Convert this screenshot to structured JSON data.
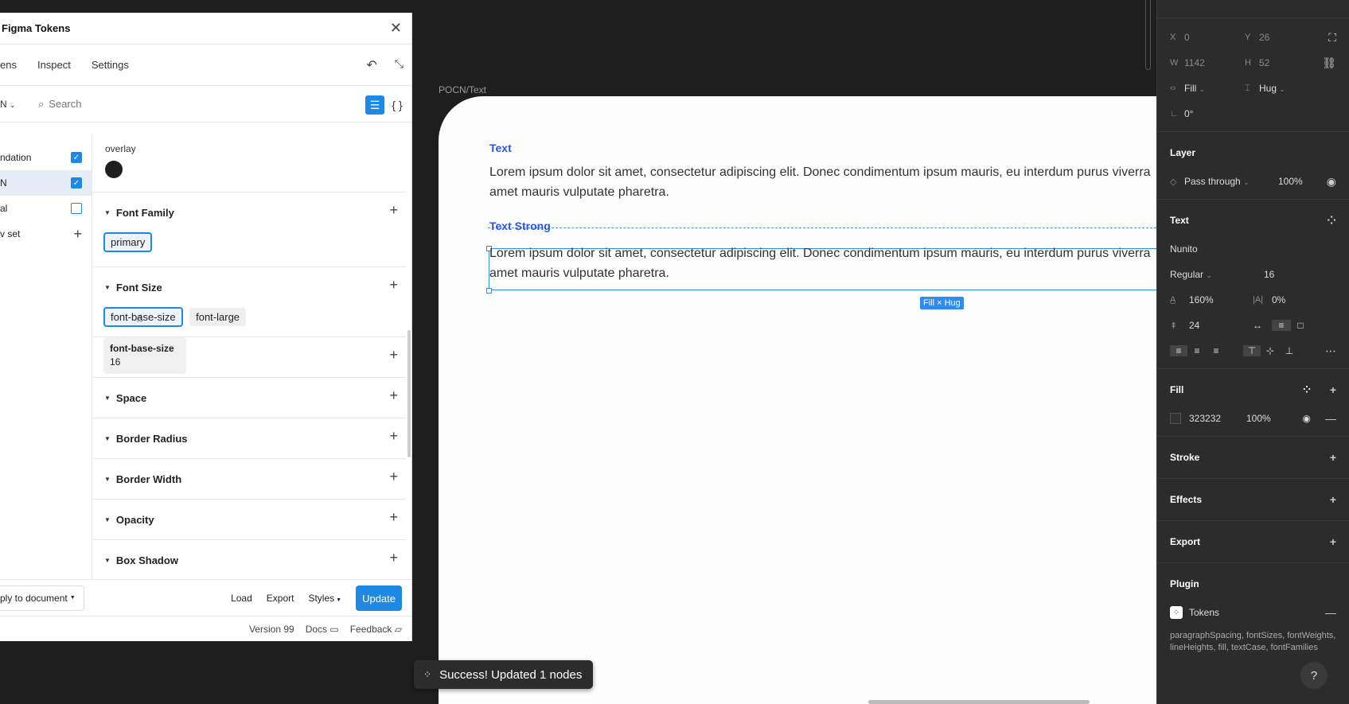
{
  "canvas": {
    "frame_label": "POCN/Text",
    "heading_1": "Text",
    "body_1_line_1": "Lorem ipsum dolor sit amet, consectetur adipiscing elit. Donec condimentum ipsum mauris, eu interdum purus viverra",
    "body_1_line_2": "amet mauris vulputate pharetra.",
    "heading_2": "Text Strong",
    "body_2_line_1": "Lorem ipsum dolor sit amet, consectetur adipiscing elit. Donec condimentum ipsum mauris, eu interdum purus viverra",
    "body_2_line_2": "amet mauris vulputate pharetra.",
    "size_badge": "Fill × Hug",
    "toast": "Success! Updated 1 nodes"
  },
  "plugin": {
    "title": "Figma Tokens",
    "tabs": [
      "ens",
      "Inspect",
      "Settings"
    ],
    "set_selector": "N",
    "search_placeholder": "Search",
    "sets": [
      {
        "label": "ndation",
        "checked": true
      },
      {
        "label": "N",
        "checked": true
      },
      {
        "label": "al",
        "checked": false
      },
      {
        "label": "v set",
        "checked": false
      }
    ],
    "overlay_label": "overlay",
    "sections": {
      "font_family": "Font Family",
      "font_family_tokens": [
        "primary"
      ],
      "font_size": "Font Size",
      "font_size_tokens": [
        "font-base-size",
        "font-large"
      ],
      "space": "Space",
      "border_radius": "Border Radius",
      "border_width": "Border Width",
      "opacity": "Opacity",
      "box_shadow": "Box Shadow"
    },
    "tooltip": {
      "name": "font-base-size",
      "value": "16"
    },
    "footer": {
      "apply": "ply to document",
      "load": "Load",
      "export": "Export",
      "styles": "Styles",
      "update": "Update"
    },
    "status": {
      "version": "Version 99",
      "docs": "Docs",
      "feedback": "Feedback"
    }
  },
  "props": {
    "x_label": "X",
    "x": "0",
    "y_label": "Y",
    "y": "26",
    "w_label": "W",
    "w": "1142",
    "h_label": "H",
    "h": "52",
    "width_mode": "Fill",
    "height_mode": "Hug",
    "rotation": "0°",
    "layer_title": "Layer",
    "blend": "Pass through",
    "layer_opacity": "100%",
    "text_title": "Text",
    "font": "Nunito",
    "weight": "Regular",
    "font_size": "16",
    "line_height": "160%",
    "letter_spacing": "0%",
    "paragraph_spacing": "24",
    "fill_title": "Fill",
    "fill_hex": "323232",
    "fill_opacity": "100%",
    "stroke_title": "Stroke",
    "effects_title": "Effects",
    "export_title": "Export",
    "plugin_title": "Plugin",
    "plugin_name": "Tokens",
    "plugin_desc": "paragraphSpacing, fontSizes, fontWeights, lineHeights, fill, textCase, fontFamilies"
  },
  "colors": {
    "accent": "#1e88e5",
    "heading_blue": "#2f55e0",
    "text": "#323232"
  }
}
